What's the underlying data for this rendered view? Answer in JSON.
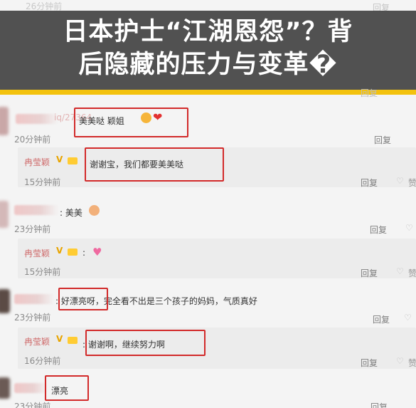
{
  "headline": {
    "line1": "日本护士“江湖恩怨”？背",
    "line2": "后隐藏的压力与变革�"
  },
  "top": {
    "time": "26分钟前",
    "reply": "回复"
  },
  "comments": [
    {
      "username": "iq/27364",
      "text": "美美哒 颖姐",
      "time": "20分钟前",
      "reply": "回复"
    },
    {
      "username": "冉莹颖",
      "text": "谢谢宝，我们都要美美哒",
      "time": "15分钟前",
      "reply": "回复"
    },
    {
      "username": "",
      "text": "美美",
      "time": "23分钟前",
      "reply": "回复"
    },
    {
      "username": "冉莹颖",
      "text": "",
      "time": "15分钟前",
      "reply": "回复"
    },
    {
      "username": "",
      "text_highlight": "好漂亮呀",
      "text_rest": "，完全看不出是三个孩子的妈妈，气质真好",
      "time": "23分钟前",
      "reply": "回复"
    },
    {
      "username": "冉莹颖",
      "text_highlight": "谢谢啊",
      "text_rest": "，继续努力啊",
      "time": "16分钟前",
      "reply": "回复"
    },
    {
      "username": "",
      "text": "漂亮",
      "time": "23分钟前",
      "reply": "回复"
    }
  ],
  "partial_reply": "回复",
  "partial_like": "赞",
  "colors": {
    "highlight": "#d22a2a",
    "banner": "#3a3a3a",
    "banner_accent": "#f3c20e"
  }
}
